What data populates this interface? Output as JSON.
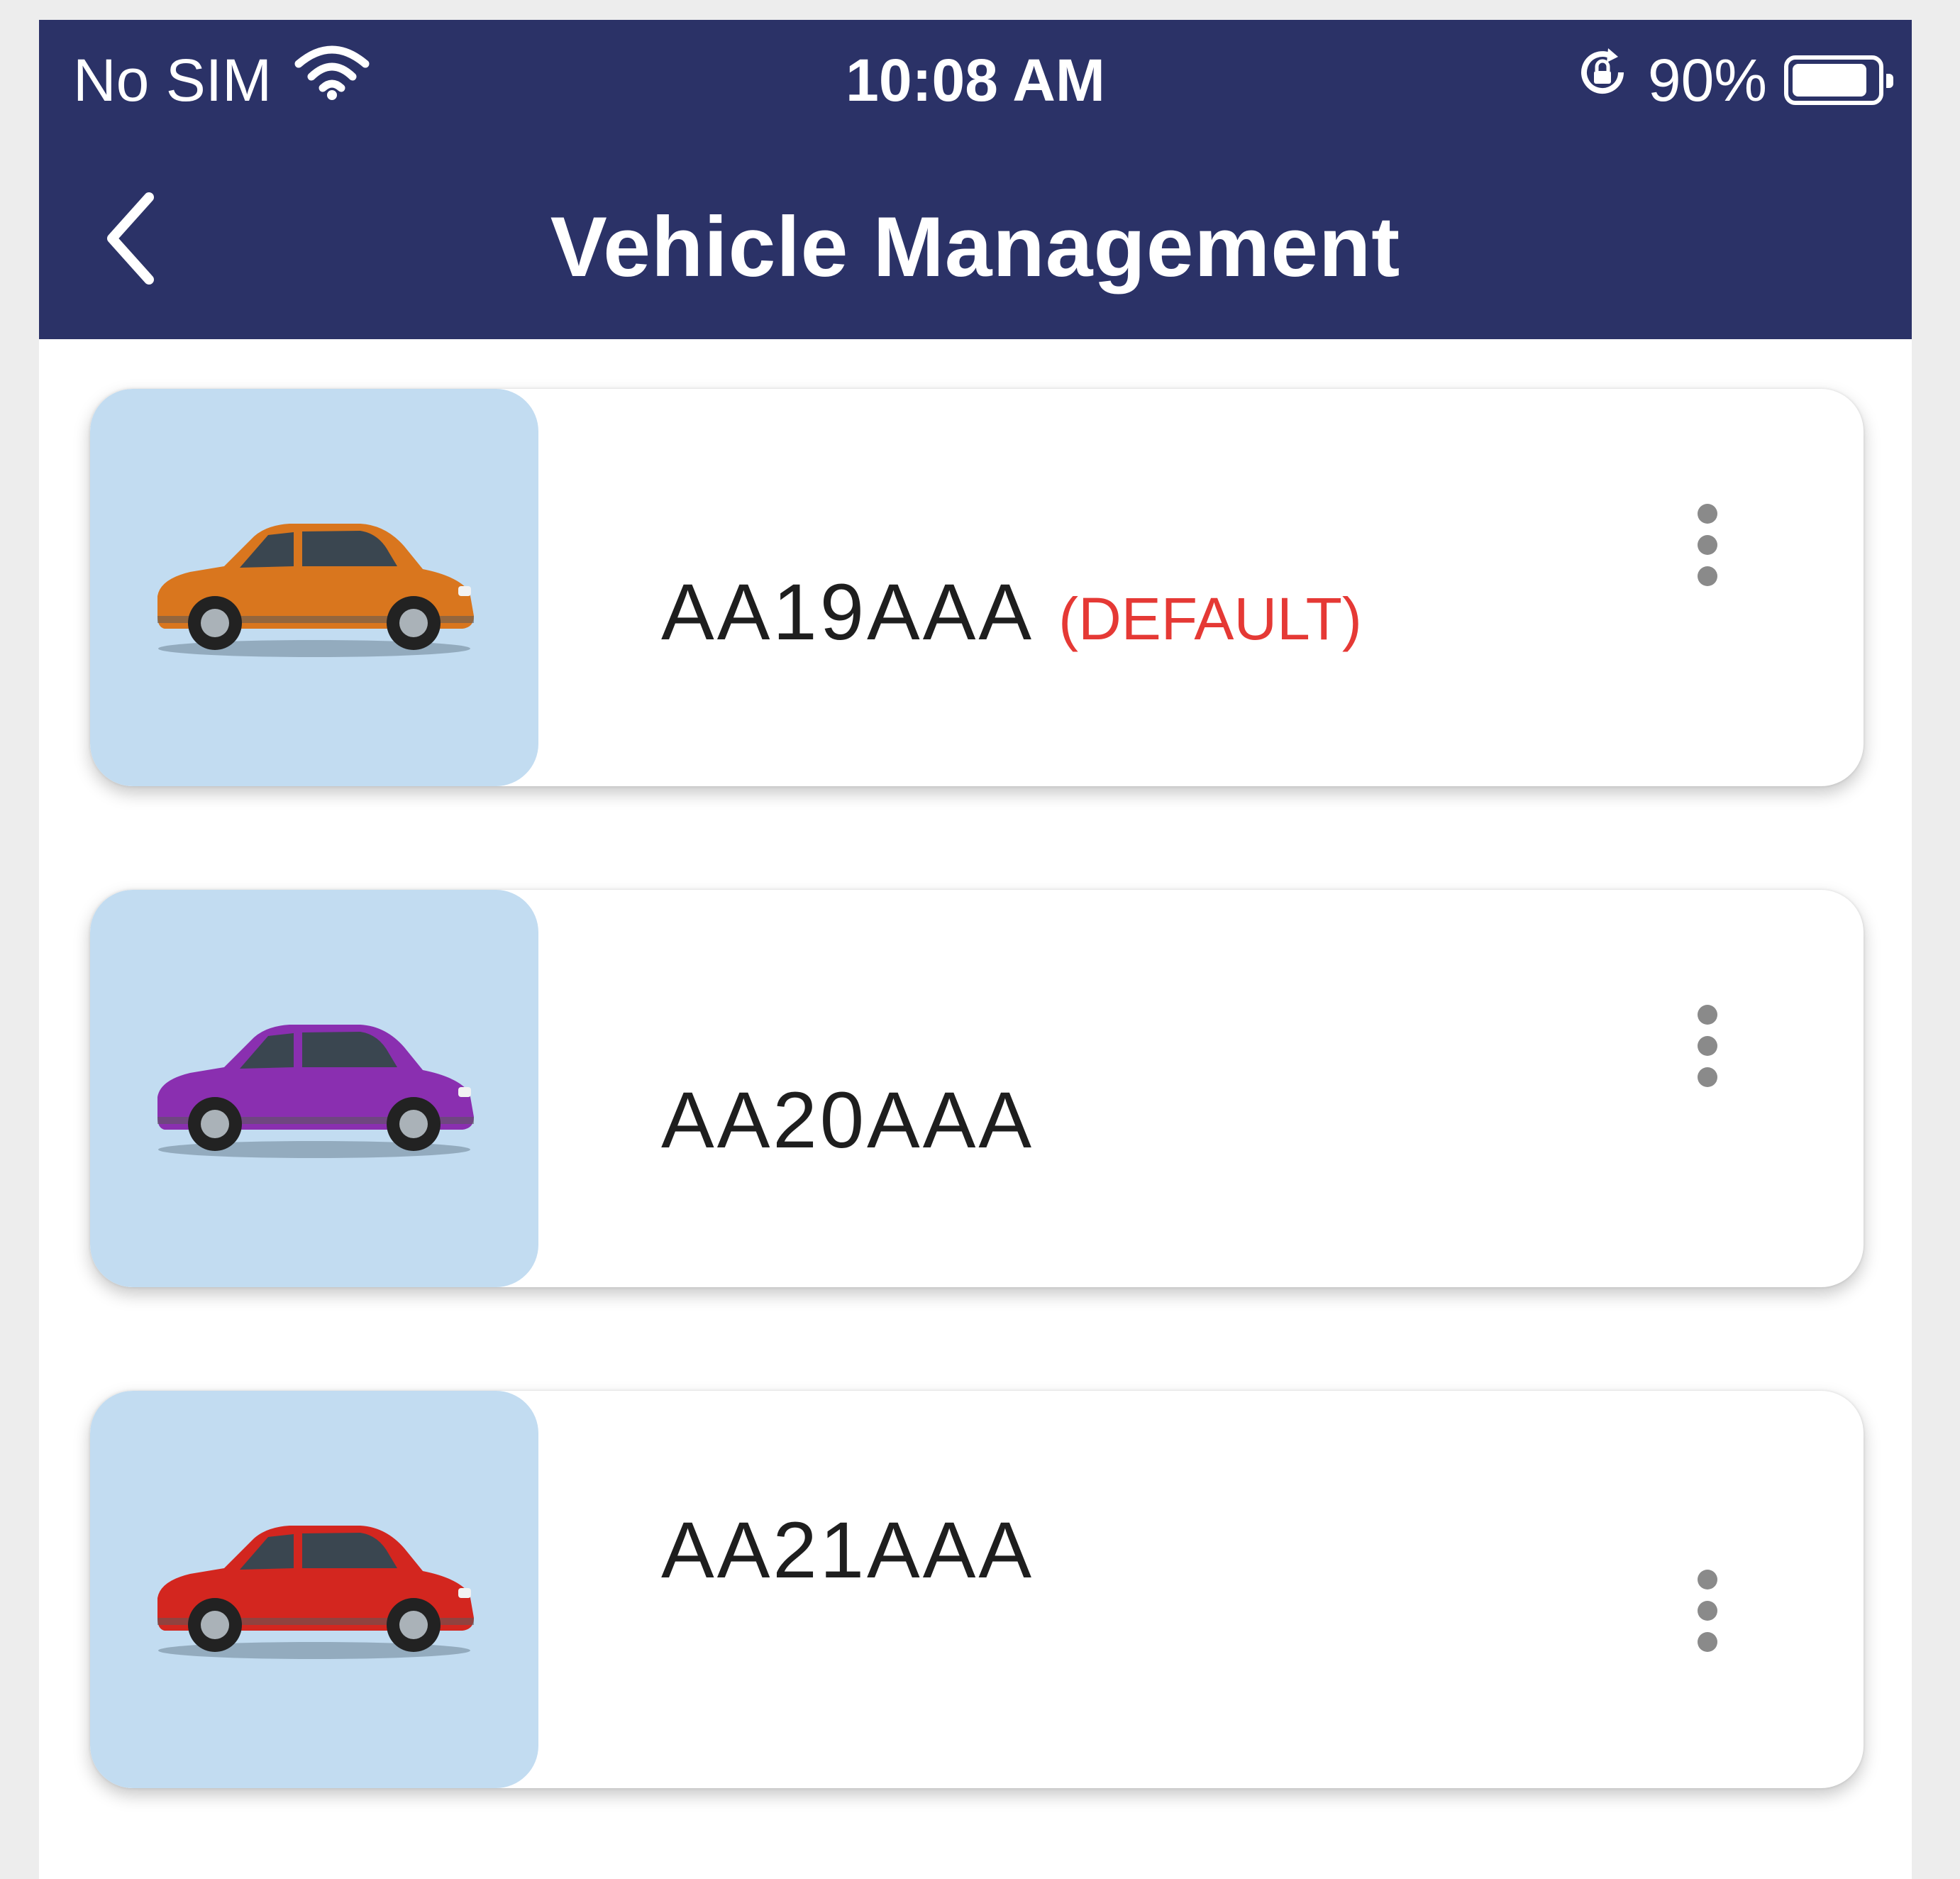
{
  "status_bar": {
    "carrier": "No SIM",
    "time": "10:08 AM",
    "battery_percent_label": "90%",
    "battery_level": 0.9,
    "wifi_icon": "wifi-icon",
    "rotation_lock_icon": "rotation-lock-icon"
  },
  "header": {
    "title": "Vehicle Management",
    "back_icon": "chevron-left-icon",
    "background": "#2b3267"
  },
  "vehicles": [
    {
      "plate": "AA19AAA",
      "tag": "(DEFAULT)",
      "car_color": "#d9761e"
    },
    {
      "plate": "AA20AAA",
      "tag": "",
      "car_color": "#8a2fb0"
    },
    {
      "plate": "AA21AAA",
      "tag": "",
      "car_color": "#d3261f"
    }
  ],
  "colors": {
    "thumb_background": "#c2dcf1",
    "default_tag": "#e53935",
    "menu_dots": "#8a8a8a"
  }
}
